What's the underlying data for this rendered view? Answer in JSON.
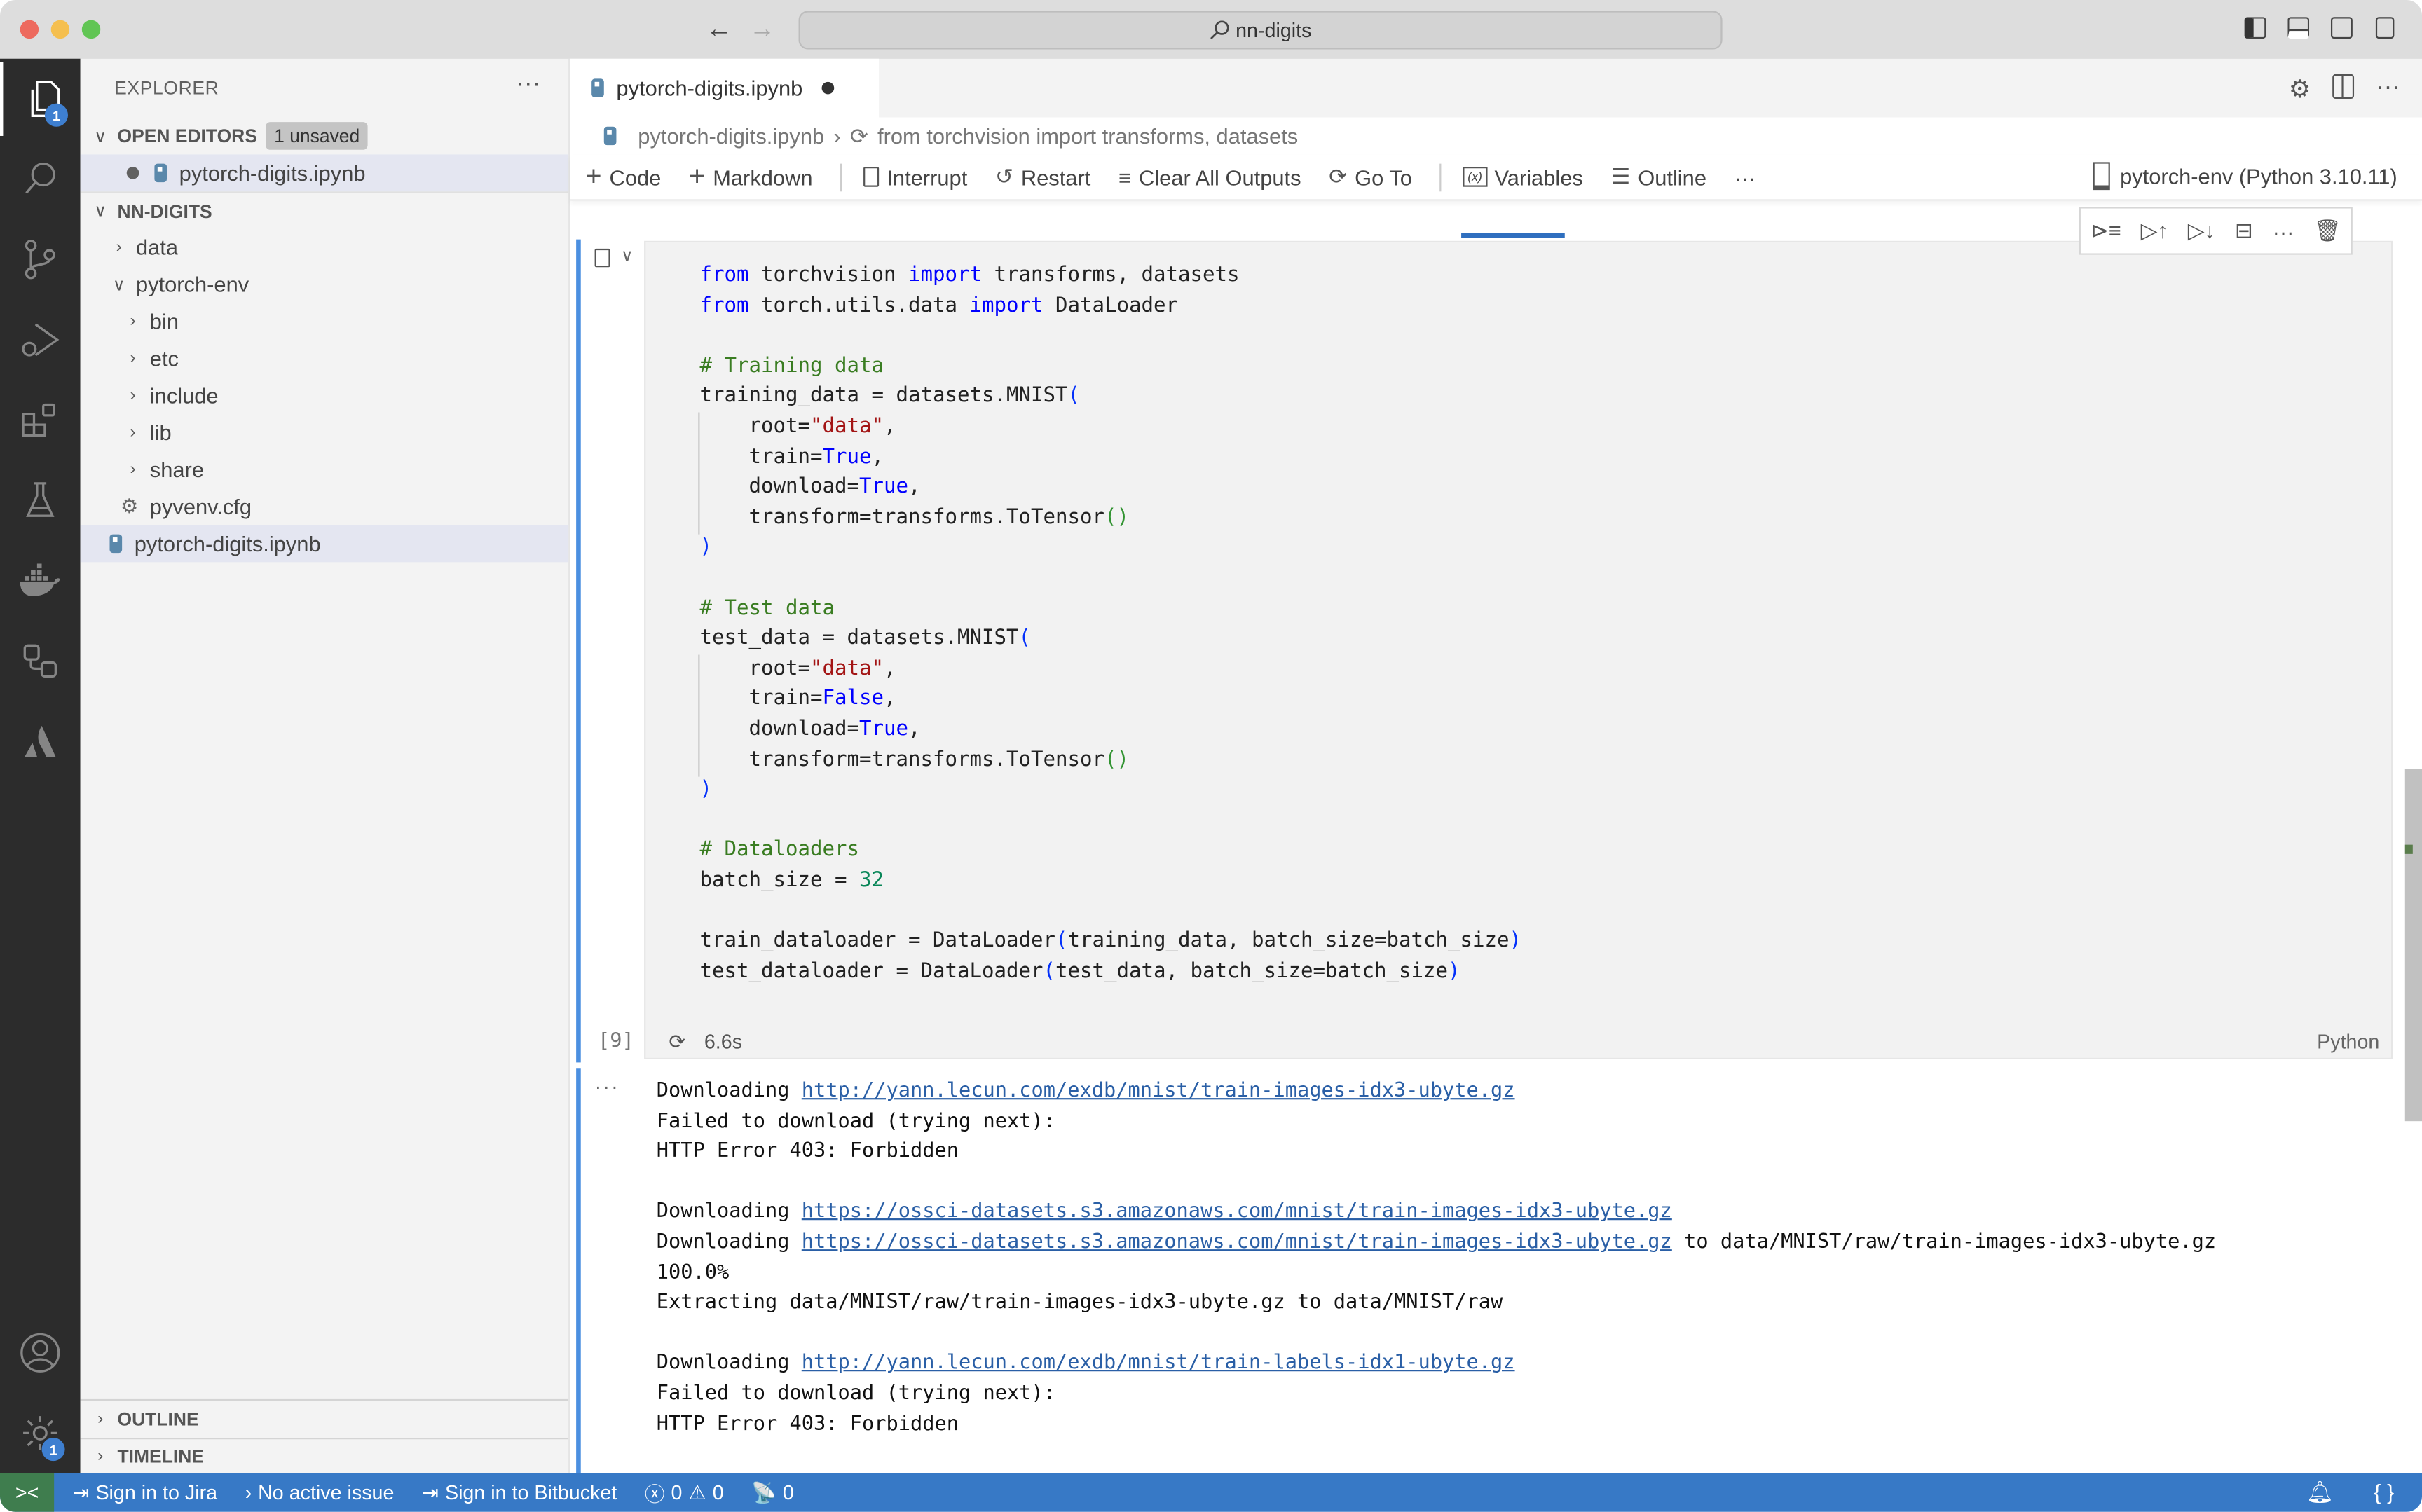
{
  "window": {
    "search_text": "nn-digits",
    "traffic_lights": {
      "close": "#ed6a5e",
      "minimize": "#f5bf4f",
      "maximize": "#61c554"
    }
  },
  "activity_bar": {
    "items": [
      {
        "name": "explorer",
        "badge": "1"
      },
      {
        "name": "search"
      },
      {
        "name": "source-control"
      },
      {
        "name": "run-debug"
      },
      {
        "name": "extensions"
      },
      {
        "name": "testing"
      },
      {
        "name": "docker"
      },
      {
        "name": "remote-explorer"
      },
      {
        "name": "atlassian"
      }
    ],
    "bottom": [
      {
        "name": "accounts"
      },
      {
        "name": "manage",
        "badge": "1"
      }
    ]
  },
  "sidebar": {
    "title": "EXPLORER",
    "open_editors": {
      "label": "OPEN EDITORS",
      "badge": "1 unsaved",
      "files": [
        {
          "name": "pytorch-digits.ipynb",
          "dirty": true
        }
      ]
    },
    "workspace": {
      "label": "NN-DIGITS",
      "tree": [
        {
          "name": "data",
          "type": "folder",
          "expanded": false,
          "depth": 1
        },
        {
          "name": "pytorch-env",
          "type": "folder",
          "expanded": true,
          "depth": 1
        },
        {
          "name": "bin",
          "type": "folder",
          "expanded": false,
          "depth": 2
        },
        {
          "name": "etc",
          "type": "folder",
          "expanded": false,
          "depth": 2
        },
        {
          "name": "include",
          "type": "folder",
          "expanded": false,
          "depth": 2
        },
        {
          "name": "lib",
          "type": "folder",
          "expanded": false,
          "depth": 2
        },
        {
          "name": "share",
          "type": "folder",
          "expanded": false,
          "depth": 2
        },
        {
          "name": "pyvenv.cfg",
          "type": "config",
          "depth": 2
        },
        {
          "name": "pytorch-digits.ipynb",
          "type": "notebook",
          "depth": 1,
          "selected": true
        }
      ]
    },
    "outline_label": "OUTLINE",
    "timeline_label": "TIMELINE"
  },
  "editor": {
    "tab": {
      "label": "pytorch-digits.ipynb",
      "dirty": true
    },
    "breadcrumb": {
      "file": "pytorch-digits.ipynb",
      "symbol": "from torchvision import transforms, datasets"
    },
    "toolbar": {
      "code": "Code",
      "markdown": "Markdown",
      "interrupt": "Interrupt",
      "restart": "Restart",
      "clear_outputs": "Clear All Outputs",
      "go_to": "Go To",
      "variables": "Variables",
      "outline": "Outline",
      "more": "···",
      "kernel": "pytorch-env (Python 3.10.11)"
    },
    "cell": {
      "execution_count": "[9]",
      "duration": "6.6s",
      "language": "Python",
      "code_lines": [
        "from torchvision import transforms, datasets",
        "from torch.utils.data import DataLoader",
        "",
        "# Training data",
        "training_data = datasets.MNIST(",
        "    root=\"data\",",
        "    train=True,",
        "    download=True,",
        "    transform=transforms.ToTensor()",
        ")",
        "",
        "# Test data",
        "test_data = datasets.MNIST(",
        "    root=\"data\",",
        "    train=False,",
        "    download=True,",
        "    transform=transforms.ToTensor()",
        ")",
        "",
        "# Dataloaders",
        "batch_size = 32",
        "",
        "train_dataloader = DataLoader(training_data, batch_size=batch_size)",
        "test_dataloader = DataLoader(test_data, batch_size=batch_size)"
      ]
    },
    "output": {
      "more": "···",
      "lines": [
        {
          "text": "Downloading ",
          "link": "http://yann.lecun.com/exdb/mnist/train-images-idx3-ubyte.gz",
          "suffix": ""
        },
        {
          "text": "Failed to download (trying next):"
        },
        {
          "text": "HTTP Error 403: Forbidden"
        },
        {
          "text": ""
        },
        {
          "text": "Downloading ",
          "link": "https://ossci-datasets.s3.amazonaws.com/mnist/train-images-idx3-ubyte.gz",
          "suffix": ""
        },
        {
          "text": "Downloading ",
          "link": "https://ossci-datasets.s3.amazonaws.com/mnist/train-images-idx3-ubyte.gz",
          "suffix": " to data/MNIST/raw/train-images-idx3-ubyte.gz"
        },
        {
          "text": "100.0%"
        },
        {
          "text": "Extracting data/MNIST/raw/train-images-idx3-ubyte.gz to data/MNIST/raw"
        },
        {
          "text": ""
        },
        {
          "text": "Downloading ",
          "link": "http://yann.lecun.com/exdb/mnist/train-labels-idx1-ubyte.gz",
          "suffix": ""
        },
        {
          "text": "Failed to download (trying next):"
        },
        {
          "text": "HTTP Error 403: Forbidden"
        }
      ]
    }
  },
  "statusbar": {
    "jira": "Sign in to Jira",
    "issue": "No active issue",
    "bitbucket": "Sign in to Bitbucket",
    "errors": "0",
    "warnings": "0",
    "ports": "0",
    "colors": {
      "background": "#3779c6",
      "remote": "#3f7d4e"
    }
  }
}
